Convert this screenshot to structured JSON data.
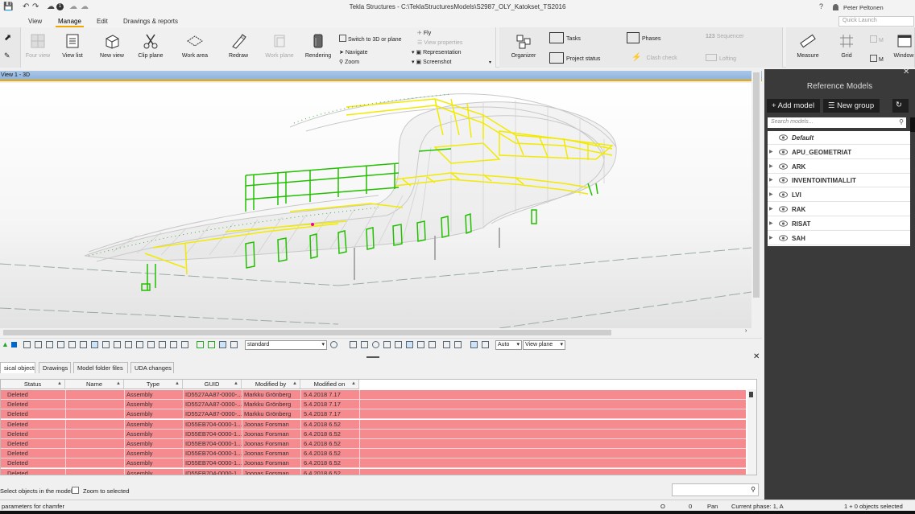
{
  "titlebar": {
    "title": "Tekla Structures - C:\\TeklaStructuresModels\\S2987_OLY_Katokset_TS2016",
    "user": "Peter Peltonen",
    "help": "?",
    "badge": "1"
  },
  "menu": {
    "tabs": [
      "View",
      "Manage",
      "Edit",
      "Drawings & reports"
    ],
    "active": "Manage",
    "quick_launch_placeholder": "Quick Launch"
  },
  "ribbon": {
    "four_view": "Four view",
    "view_list": "View list",
    "new_view": "New view",
    "clip_plane": "Clip plane",
    "work_area": "Work area",
    "redraw": "Redraw",
    "work_plane": "Work plane",
    "rendering": "Rendering",
    "switch_3d": "Switch to 3D or plane",
    "navigate": "Navigate",
    "zoom": "Zoom",
    "fly": "Fly",
    "view_properties": "View properties",
    "representation": "Representation",
    "screenshot": "Screenshot",
    "organizer": "Organizer",
    "tasks": "Tasks",
    "project_status": "Project status",
    "phases": "Phases",
    "clash_check": "Clash check",
    "sequencer": "Sequencer",
    "lofting": "Lofting",
    "measure": "Measure",
    "grid": "Grid",
    "more": "M",
    "window": "Window"
  },
  "view": {
    "title": "View 1 - 3D",
    "accent": "#f0a800"
  },
  "view_toolbar": {
    "filter_value": "standard",
    "snap_mode": "Auto",
    "plane_mode": "View plane"
  },
  "lower_panel": {
    "tabs": [
      "sical objects",
      "Drawings",
      "Model folder files",
      "UDA changes"
    ],
    "columns": [
      "Status",
      "Name",
      "Type",
      "GUID",
      "Modified by",
      "Modified on"
    ],
    "rows": [
      [
        "Deleted",
        "",
        "Assembly",
        "ID5527AA87-0000-...",
        "Markku Grönberg",
        "5.4.2018 7.17"
      ],
      [
        "Deleted",
        "",
        "Assembly",
        "ID5527AA87-0000-...",
        "Markku Grönberg",
        "5.4.2018 7.17"
      ],
      [
        "Deleted",
        "",
        "Assembly",
        "ID5527AA87-0000-...",
        "Markku Grönberg",
        "5.4.2018 7.17"
      ],
      [
        "Deleted",
        "",
        "Assembly",
        "ID55EB704-0000-1...",
        "Joonas Forsman",
        "6.4.2018 6.52"
      ],
      [
        "Deleted",
        "",
        "Assembly",
        "ID55EB704-0000-1...",
        "Joonas Forsman",
        "6.4.2018 6.52"
      ],
      [
        "Deleted",
        "",
        "Assembly",
        "ID55EB704-0000-1...",
        "Joonas Forsman",
        "6.4.2018 6.52"
      ],
      [
        "Deleted",
        "",
        "Assembly",
        "ID55EB704-0000-1...",
        "Joonas Forsman",
        "6.4.2018 6.52"
      ],
      [
        "Deleted",
        "",
        "Assembly",
        "ID55EB704-0000-1...",
        "Joonas Forsman",
        "6.4.2018 6.52"
      ],
      [
        "Deleted",
        "",
        "Assembly",
        "ID55EB704-0000-1...",
        "Joonas Forsman",
        "6.4.2018 6.52"
      ]
    ],
    "deleted_color": "#f58a8f",
    "select_label": "Select objects in the model",
    "zoom_label": "Zoom to selected"
  },
  "statusbar": {
    "prompt": "parameters for chamfer",
    "val1": "O",
    "val2": "0",
    "mode": "Pan",
    "phase": "Current phase: 1, A",
    "selection": "1 + 0 objects selected"
  },
  "reference_models": {
    "title": "Reference Models",
    "add_model": "+ Add model",
    "new_group": "New group",
    "search_placeholder": "Search models...",
    "items": [
      "Default",
      "APU_GEOMETRIAT",
      "ARK",
      "INVENTOINTIMALLIT",
      "LVI",
      "RAK",
      "RISAT",
      "SAH"
    ]
  }
}
